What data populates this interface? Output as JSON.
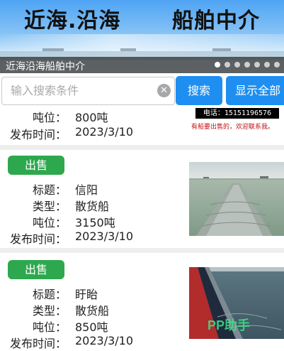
{
  "banner": {
    "title_left": "近海.沿海",
    "title_right": "船舶中介",
    "caption": "近海沿海船舶中介",
    "slide_count": 7,
    "active_slide": 1
  },
  "search": {
    "placeholder": "输入搜索条件",
    "value": "",
    "clear_icon": "clear-icon",
    "search_label": "搜索",
    "show_all_label": "显示全部"
  },
  "labels": {
    "title": "标题：",
    "type": "类型：",
    "tonnage": "吨位：",
    "published": "发布时间："
  },
  "listings": [
    {
      "tonnage": "800吨",
      "published": "2023/3/10",
      "phone": "电话：15151196576",
      "promo": "有船要出售的，欢迎联系我。"
    },
    {
      "badge": "出售",
      "title": "信阳",
      "type": "散货船",
      "tonnage": "3150吨",
      "published": "2023/3/10"
    },
    {
      "badge": "出售",
      "title": "盱眙",
      "type": "散货船",
      "tonnage": "850吨",
      "published": "2023/3/10",
      "watermark": "PP助手"
    }
  ],
  "colors": {
    "accent_blue": "#1e8ff0",
    "badge_green": "#2ea84e",
    "promo_red": "#c01010"
  }
}
